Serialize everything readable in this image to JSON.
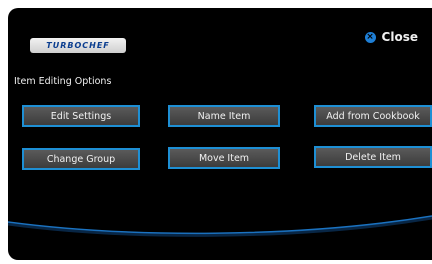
{
  "brand": {
    "logo_text": "TURBOCHEF"
  },
  "header": {
    "close_label": "Close",
    "close_icon": "close-circle-icon"
  },
  "section": {
    "title": "Item Editing Options"
  },
  "buttons": {
    "edit_settings": "Edit Settings",
    "name_item": "Name Item",
    "add_from_cookbook": "Add from Cookbook",
    "change_group": "Change Group",
    "move_item": "Move Item",
    "delete_item": "Delete Item"
  },
  "colors": {
    "accent": "#1e8fd4",
    "background": "#000000",
    "button_fill": "#4a4a4a",
    "logo_text": "#0a3d8f"
  }
}
